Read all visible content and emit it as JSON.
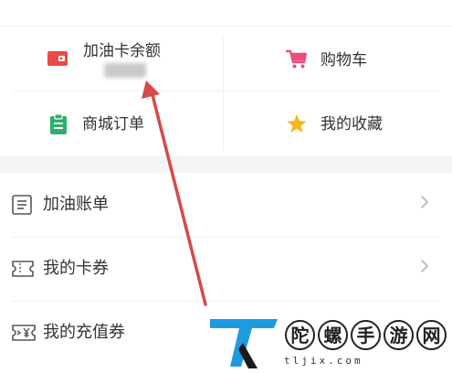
{
  "quick_grid": {
    "fuel_card_balance": {
      "label": "加油卡余额",
      "icon": "fuel-card-icon"
    },
    "shopping_cart": {
      "label": "购物车",
      "icon": "shopping-cart-icon"
    },
    "mall_orders": {
      "label": "商城订单",
      "icon": "clipboard-icon"
    },
    "favorites": {
      "label": "我的收藏",
      "icon": "star-icon"
    }
  },
  "menu": [
    {
      "label": "加油账单",
      "icon": "bill-icon",
      "has_chevron": true
    },
    {
      "label": "我的卡券",
      "icon": "ticket-icon",
      "has_chevron": true
    },
    {
      "label": "我的充值券",
      "icon": "yuan-voucher-icon",
      "has_chevron": false
    }
  ],
  "watermark": {
    "brand_chars": [
      "陀",
      "螺",
      "手",
      "游",
      "网"
    ],
    "url": "tljix.com"
  },
  "colors": {
    "fuel_card_icon": "#e94b45",
    "cart_icon": "#e94f7c",
    "clipboard_icon": "#2fae6c",
    "star_icon": "#f5b720",
    "annotation_arrow": "#d9484a",
    "watermark_blue": "#1e9be0"
  }
}
